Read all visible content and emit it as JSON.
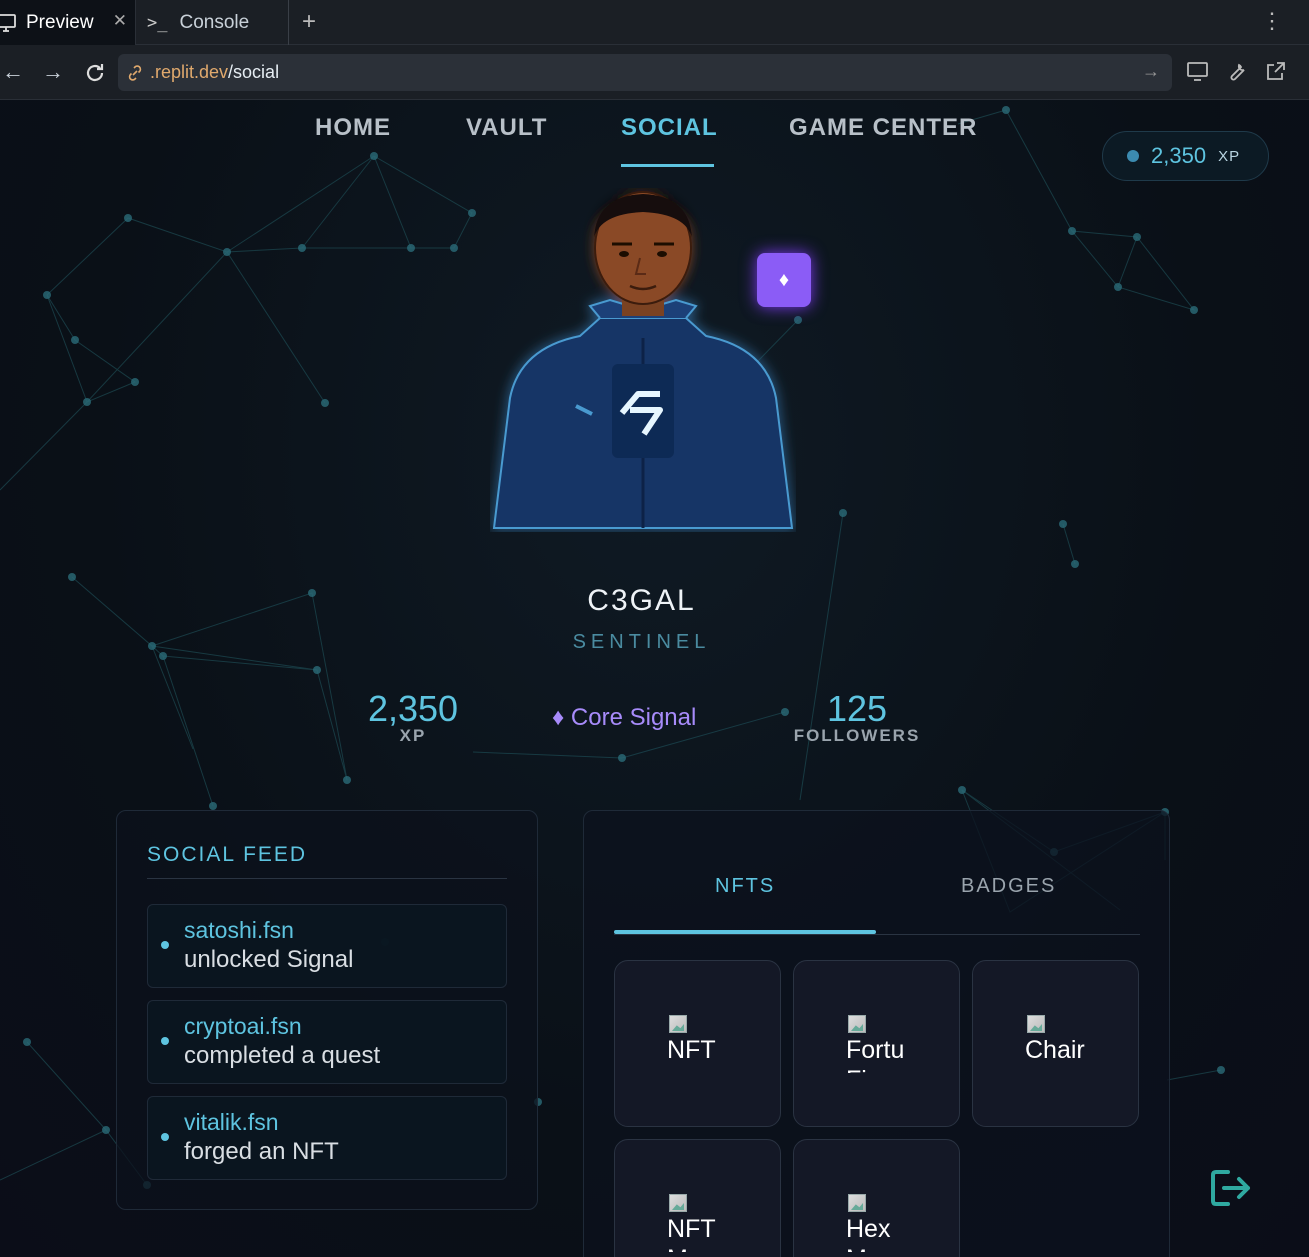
{
  "browser": {
    "tabs": [
      {
        "label": "Preview",
        "active": true
      },
      {
        "label": "Console",
        "active": false
      }
    ],
    "url": {
      "domain": ".replit.dev",
      "path": "/social"
    }
  },
  "nav": {
    "items": [
      {
        "label": "HOME",
        "active": false
      },
      {
        "label": "VAULT",
        "active": false
      },
      {
        "label": "SOCIAL",
        "active": true
      },
      {
        "label": "GAME CENTER",
        "active": false
      }
    ]
  },
  "xp_pill": {
    "value": "2,350",
    "unit": "XP"
  },
  "profile": {
    "username": "C3GAL",
    "rank": "SENTINEL",
    "xp": {
      "value": "2,350",
      "label": "XP"
    },
    "tier": {
      "icon": "♦",
      "label": "Core Signal"
    },
    "followers": {
      "value": "125",
      "label": "FOLLOWERS"
    }
  },
  "feed": {
    "title": "SOCIAL FEED",
    "items": [
      {
        "user": "satoshi.fsn",
        "action": "unlocked Signal"
      },
      {
        "user": "cryptoai.fsn",
        "action": "completed a quest"
      },
      {
        "user": "vitalik.fsn",
        "action": "forged an NFT"
      }
    ]
  },
  "collection": {
    "tabs": [
      {
        "label": "NFTS",
        "active": true
      },
      {
        "label": "BADGES",
        "active": false
      }
    ],
    "cards": [
      {
        "alt": "NFT",
        "alt2": "—"
      },
      {
        "alt": "Fortu",
        "alt2": "Fi"
      },
      {
        "alt": "Chair",
        "alt2": ""
      },
      {
        "alt": "NFT",
        "alt2": "M"
      },
      {
        "alt": "Hex",
        "alt2": "M"
      }
    ]
  },
  "colors": {
    "accent": "#5ec4e0",
    "purple": "#8b5cf6",
    "background": "#0b1118"
  }
}
